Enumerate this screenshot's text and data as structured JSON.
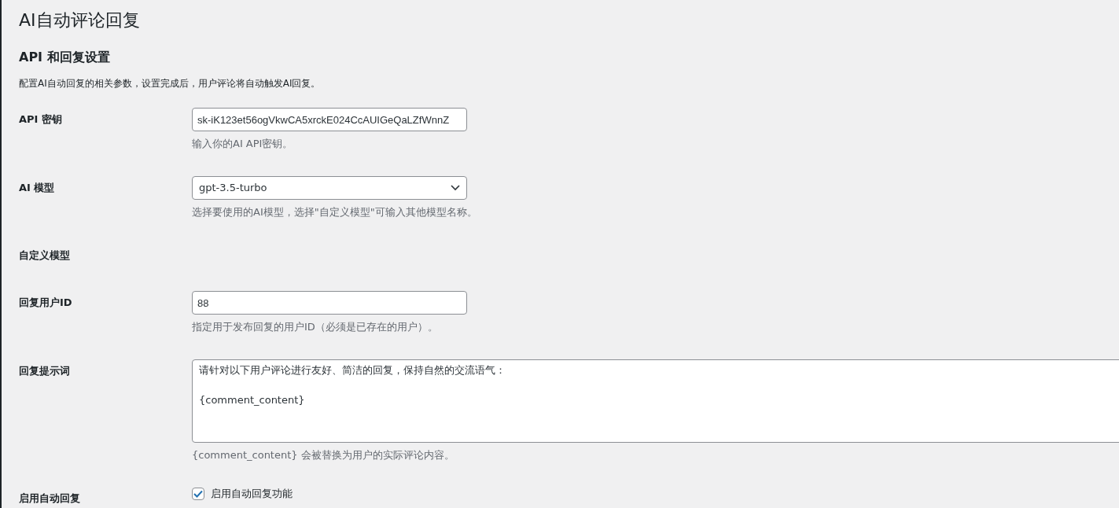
{
  "title": "AI自动评论回复",
  "section": {
    "heading": "API 和回复设置",
    "description": "配置AI自动回复的相关参数，设置完成后，用户评论将自动触发AI回复。"
  },
  "fields": [
    {
      "kind": "text",
      "label": "API 密钥",
      "value": "sk-iK123et56ogVkwCA5xrckE024CcAUIGeQaLZfWnnZ",
      "help": "输入你的AI API密钥。"
    },
    {
      "kind": "select",
      "label": "AI 模型",
      "value": "gpt-3.5-turbo",
      "help": "选择要使用的AI模型，选择\"自定义模型\"可输入其他模型名称。"
    },
    {
      "kind": "empty",
      "label": "自定义模型"
    },
    {
      "kind": "text",
      "label": "回复用户ID",
      "value": "88",
      "help": "指定用于发布回复的用户ID（必须是已存在的用户）。"
    },
    {
      "kind": "textarea",
      "label": "回复提示词",
      "value": "请针对以下用户评论进行友好、简洁的回复，保持自然的交流语气：\n\n{comment_content}",
      "help": "{comment_content} 会被替换为用户的实际评论内容。"
    },
    {
      "kind": "checkbox",
      "label": "启用自动回复",
      "option": "启用自动回复功能",
      "checked": true
    }
  ]
}
